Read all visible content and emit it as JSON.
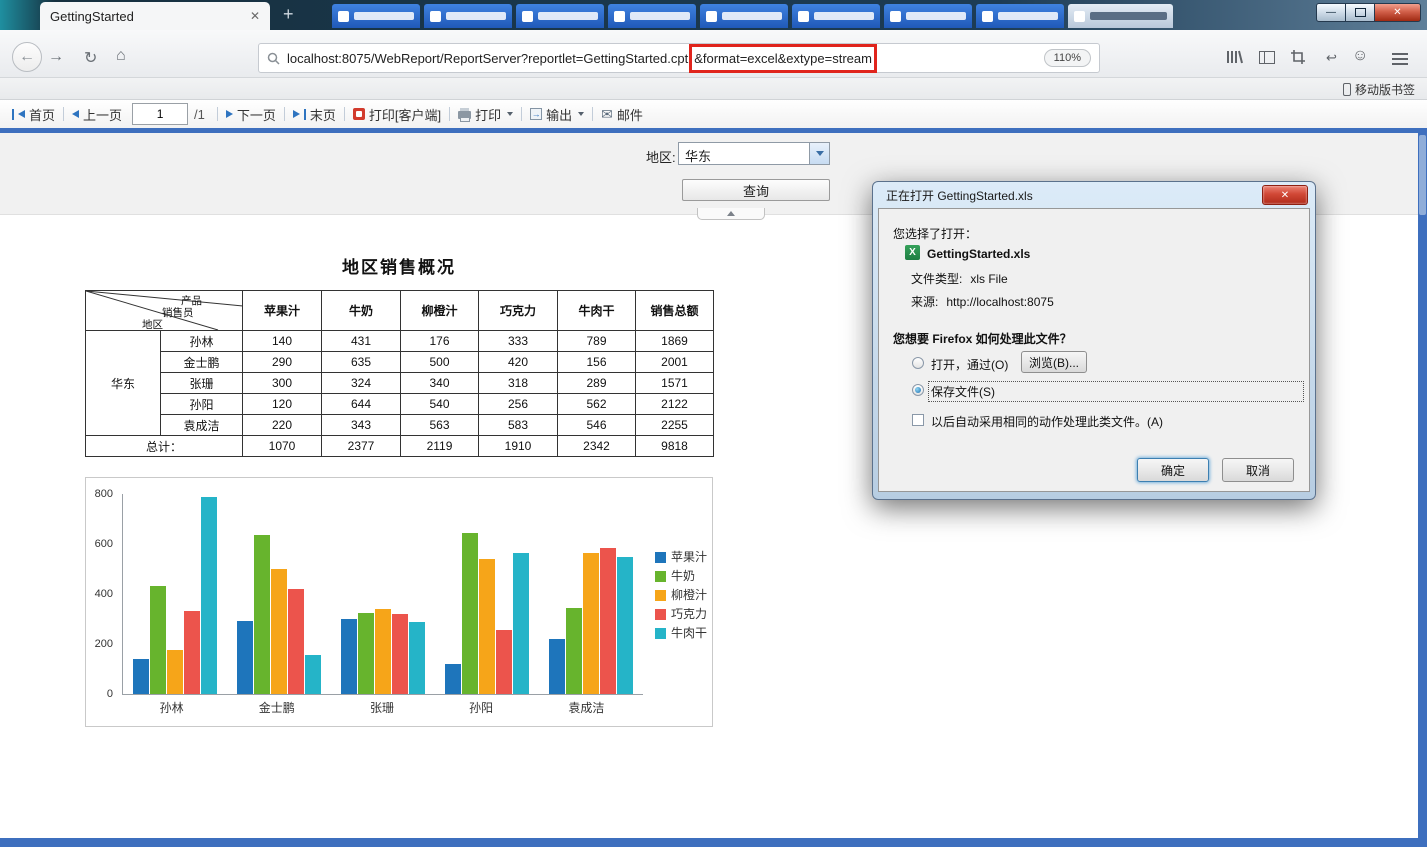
{
  "browser": {
    "active_tab": {
      "title": "GettingStarted"
    },
    "background_tabs_count": 8,
    "url": {
      "prefix": "localhost:8075/WebReport/ReportServer?reportlet=GettingStarted.cpt",
      "highlighted": "&format=excel&extype=stream",
      "highlight_color": "#e0241c",
      "zoom": "110%"
    },
    "bookmarks": {
      "mobile": "移动版书签"
    }
  },
  "icons": {
    "back": "←",
    "forward": "→",
    "reload": "↻",
    "home": "⌂",
    "close": "✕",
    "minimize": "—",
    "new_tab": "+",
    "mail": "✉",
    "profile": "☺",
    "undo": "↩"
  },
  "report_toolbar": {
    "first": "首页",
    "prev": "上一页",
    "page_value": "1",
    "page_total": "/1",
    "next": "下一页",
    "last": "末页",
    "print_client": "打印[客户端]",
    "print": "打印",
    "export": "输出",
    "email": "邮件"
  },
  "param_pane": {
    "region_label": "地区:",
    "region_value": "华东",
    "query_button": "查询"
  },
  "report": {
    "title": "地区销售概况",
    "table": {
      "diagonal": {
        "top": "产品",
        "middle": "销售员",
        "bottom": "地区"
      },
      "columns": [
        "苹果汁",
        "牛奶",
        "柳橙汁",
        "巧克力",
        "牛肉干",
        "销售总额"
      ],
      "region": "华东",
      "rows": [
        {
          "name": "孙林",
          "values": [
            140,
            431,
            176,
            333,
            789,
            1869
          ]
        },
        {
          "name": "金士鹏",
          "values": [
            290,
            635,
            500,
            420,
            156,
            2001
          ]
        },
        {
          "name": "张珊",
          "values": [
            300,
            324,
            340,
            318,
            289,
            1571
          ]
        },
        {
          "name": "孙阳",
          "values": [
            120,
            644,
            540,
            256,
            562,
            2122
          ]
        },
        {
          "name": "袁成洁",
          "values": [
            220,
            343,
            563,
            583,
            546,
            2255
          ]
        }
      ],
      "total_label": "总计：",
      "totals": [
        1070,
        2377,
        2119,
        1910,
        2342,
        9818
      ]
    }
  },
  "chart_data": {
    "type": "bar",
    "title": "",
    "xlabel": "",
    "ylabel": "",
    "categories": [
      "孙林",
      "金士鹏",
      "张珊",
      "孙阳",
      "袁成洁"
    ],
    "series": [
      {
        "name": "苹果汁",
        "color": "#1e75bb",
        "values": [
          140,
          290,
          300,
          120,
          220
        ]
      },
      {
        "name": "牛奶",
        "color": "#67b42d",
        "values": [
          431,
          635,
          324,
          644,
          343
        ]
      },
      {
        "name": "柳橙汁",
        "color": "#f6a519",
        "values": [
          176,
          500,
          340,
          540,
          563
        ]
      },
      {
        "name": "巧克力",
        "color": "#ec544c",
        "values": [
          333,
          420,
          318,
          256,
          583
        ]
      },
      {
        "name": "牛肉干",
        "color": "#25b4c8",
        "values": [
          789,
          156,
          289,
          562,
          546
        ]
      }
    ],
    "ylim": [
      0,
      800
    ],
    "yticks": [
      0,
      200,
      400,
      600,
      800
    ],
    "legend_position": "right",
    "grid": false
  },
  "dialog": {
    "title": "正在打开 GettingStarted.xls",
    "chosen_label": "您选择了打开：",
    "filename": "GettingStarted.xls",
    "filetype_label": "文件类型:",
    "filetype_value": "xls File",
    "source_label": "来源:",
    "source_value": "http://localhost:8075",
    "question": "您想要 Firefox 如何处理此文件？",
    "open_with_label": "打开，通过(O)",
    "browse_button": "浏览(B)...",
    "save_label": "保存文件(S)",
    "remember_label": "以后自动采用相同的动作处理此类文件。(A)",
    "ok_button": "确定",
    "cancel_button": "取消"
  }
}
